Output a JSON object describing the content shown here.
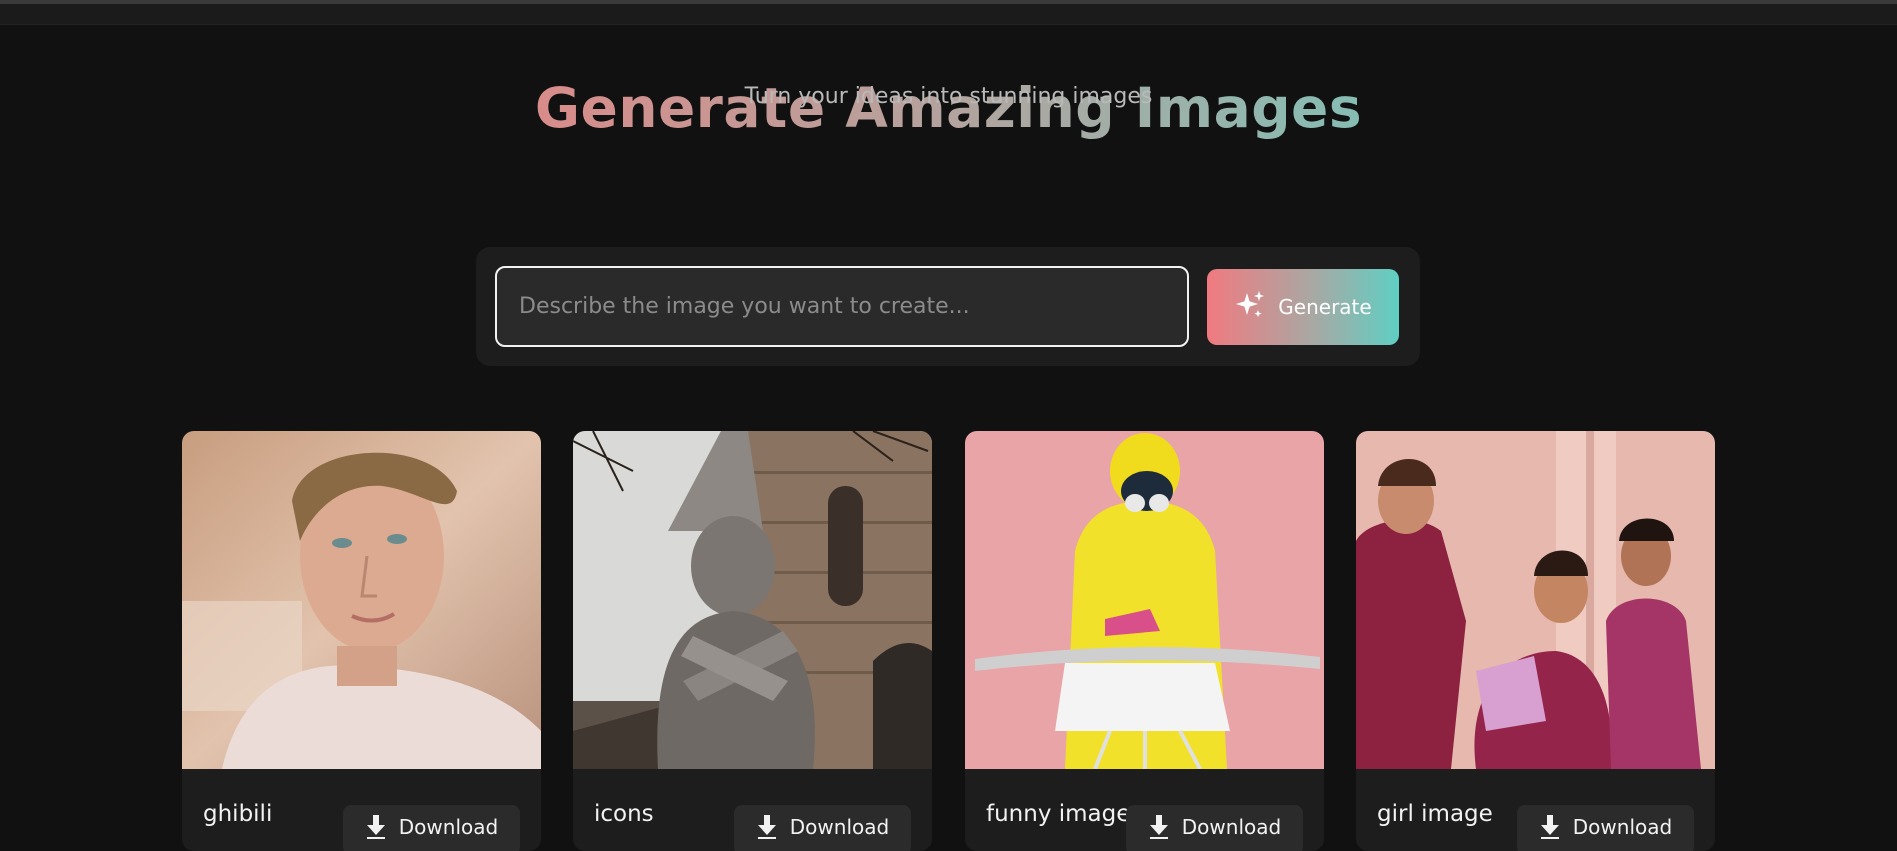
{
  "hero": {
    "title": "Generate Amazing Images",
    "subtitle": "Turn your ideas into stunning images"
  },
  "prompt": {
    "placeholder": "Describe the image you want to create...",
    "value": "",
    "generate_label": "Generate",
    "generate_icon": "sparkles-icon"
  },
  "gallery": {
    "cards": [
      {
        "caption": "ghibili",
        "download_label": "Download",
        "image": "portrait of a young man in white t-shirt"
      },
      {
        "caption": "icons",
        "download_label": "Download",
        "image": "stone statue with tall pointed hat"
      },
      {
        "caption": "funny image",
        "download_label": "Download",
        "image": "person in yellow hazmat suit ironing a shirt"
      },
      {
        "caption": "girl image",
        "download_label": "Download",
        "image": "three girls in maroon tracksuits reading"
      }
    ]
  },
  "colors": {
    "background": "#111111",
    "panel": "#1d1d1d",
    "title_gradient": [
      "#d88c8a",
      "#b4a39e",
      "#86bdb3"
    ],
    "button_gradient": [
      "#f07a80",
      "#5fcfc4"
    ]
  }
}
